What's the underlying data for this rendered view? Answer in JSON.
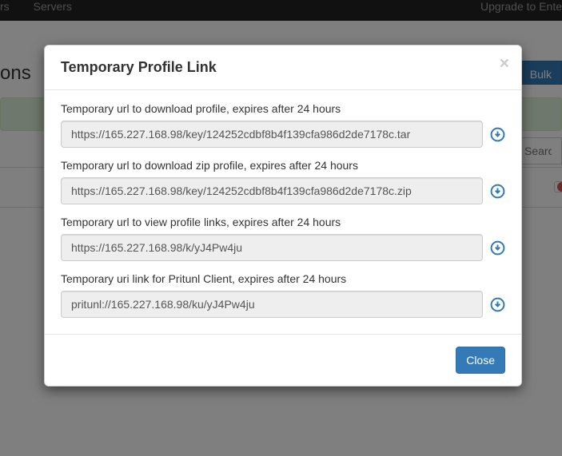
{
  "navbar": {
    "item_users": "rs",
    "item_servers": "Servers",
    "upgrade": "Upgrade to Ente"
  },
  "header": {
    "title_fragment": "ons",
    "btn1": "",
    "btn2": "",
    "btn_bulk": "Bulk"
  },
  "search": {
    "placeholder": "Search"
  },
  "modal": {
    "title": "Temporary Profile Link",
    "close_symbol": "×",
    "fields": [
      {
        "label": "Temporary url to download profile, expires after 24 hours",
        "value": "https://165.227.168.98/key/124252cdbf8b4f139cfa986d2de7178c.tar"
      },
      {
        "label": "Temporary url to download zip profile, expires after 24 hours",
        "value": "https://165.227.168.98/key/124252cdbf8b4f139cfa986d2de7178c.zip"
      },
      {
        "label": "Temporary url to view profile links, expires after 24 hours",
        "value": "https://165.227.168.98/k/yJ4Pw4ju"
      },
      {
        "label": "Temporary uri link for Pritunl Client, expires after 24 hours",
        "value": "pritunl://165.227.168.98/ku/yJ4Pw4ju"
      }
    ],
    "close_button": "Close"
  }
}
